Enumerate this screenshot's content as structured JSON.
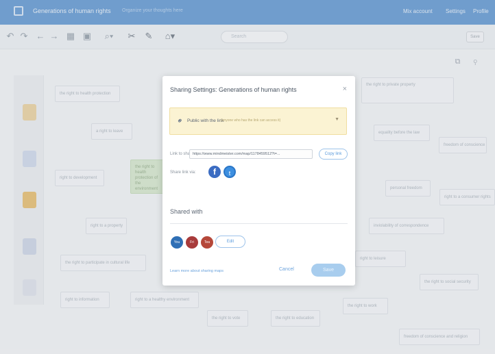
{
  "app": {
    "title": "Generations of human rights",
    "subtitle": "Organize your thoughts here",
    "menu": [
      "Mix account",
      "Settings",
      "Profile"
    ]
  },
  "toolbar": {
    "search_placeholder": "Search",
    "right_button": "Save",
    "icons": [
      "undo-icon",
      "redo-icon",
      "back-icon",
      "forward-icon",
      "layout-icon",
      "outline-icon",
      "zoom-icon",
      "cut-icon",
      "brush-icon",
      "theme-icon"
    ]
  },
  "canvas": {
    "nodes": [
      "the right to health protection",
      "the right to private property",
      "a right to leave",
      "right to development",
      "the right to health protection of the environment",
      "right to a property",
      "the right to participate in cultural life",
      "right to information",
      "right to a healthy environment",
      "the right to vote",
      "the right to education",
      "the right to work",
      "right to leisure",
      "equality before the law",
      "personal freedom",
      "right to a consumer rights",
      "inviolability of correspondence",
      "freedom of conscience",
      "the right to social security",
      "freedom of conscience and religion"
    ]
  },
  "modal": {
    "title": "Sharing Settings: Generations of human rights",
    "close": "×",
    "access_label": "Public with the link",
    "access_desc": "(anyone who has the link can access it)",
    "link_label": "Link to share:",
    "link_value": "https://www.mindmeister.com/map/1178459512?t=...",
    "copy_label": "Copy link",
    "share_label": "Share link via:",
    "shared_with_title": "Shared with",
    "collaborators": [
      {
        "initials": "You",
        "color": "#2f6fb5"
      },
      {
        "initials": "Fri",
        "color": "#a83b3b"
      },
      {
        "initials": "Tea",
        "color": "#b5483a"
      }
    ],
    "edit_label": "Edit",
    "learn_more": "Learn more about sharing maps",
    "cancel_label": "Cancel",
    "save_label": "Save"
  }
}
